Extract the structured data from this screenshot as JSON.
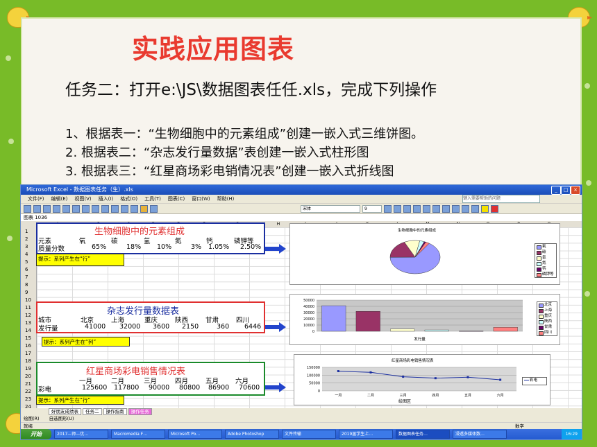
{
  "slide": {
    "title": "实践应用图表",
    "task": "任务二：打开e:\\JS\\数据图表任任.xls，完成下列操作",
    "steps": [
      "1、根据表一：“生物细胞中的元素组成”创建一嵌入式三维饼图。",
      "2.   根据表二：“杂志发行量数据”表创建一嵌入式柱形图",
      "3.   根据表三：“红星商场彩电销情况表”创建一嵌入式折线图"
    ]
  },
  "excel": {
    "window_title": "Microsoft Excel - 数据图表任务（生）.xls",
    "menu": [
      "文件(F)",
      "编辑(E)",
      "视图(V)",
      "插入(I)",
      "格式(O)",
      "工具(T)",
      "图表(C)",
      "窗口(W)",
      "帮助(H)"
    ],
    "help_placeholder": "键入需要帮助的问题",
    "font_name": "宋体",
    "font_size": "9",
    "name_box": "图表 1036",
    "columns": [
      "A",
      "B",
      "C",
      "D",
      "E",
      "F",
      "G",
      "H",
      "I",
      "J",
      "K",
      "L",
      "M",
      "N",
      "O",
      "P",
      "Q"
    ],
    "rows": [
      "1",
      "2",
      "3",
      "4",
      "5",
      "6",
      "7",
      "8",
      "9",
      "10",
      "11",
      "12",
      "13",
      "14",
      "15",
      "16",
      "17",
      "18",
      "19",
      "20",
      "21",
      "22",
      "23",
      "24"
    ],
    "table1": {
      "title": "生物细胞中的元素组成",
      "headers": [
        "元素",
        "氧",
        "碳",
        "氢",
        "氮",
        "钙",
        "磷钾等"
      ],
      "row_label": "质量分数",
      "values": [
        "65%",
        "18%",
        "10%",
        "3%",
        "1.05%",
        "2.50%"
      ],
      "hint": "提示：系列产生在“行”"
    },
    "table2": {
      "title": "杂志发行量数据表",
      "headers": [
        "城市",
        "北京",
        "上海",
        "重庆",
        "陕西",
        "甘肃",
        "四川"
      ],
      "row_label": "发行量",
      "values": [
        "41000",
        "32000",
        "3600",
        "2150",
        "360",
        "6446"
      ],
      "hint": "提示：系列产生在“列”"
    },
    "table3": {
      "title": "红星商场彩电销售情况表",
      "headers": [
        "",
        "一月",
        "二月",
        "三月",
        "四月",
        "五月",
        "六月"
      ],
      "row_label": "彩电",
      "values": [
        "125600",
        "117800",
        "90000",
        "80800",
        "86900",
        "70600"
      ],
      "hint": "提示：系列产生在“行”"
    },
    "sheet_tabs": [
      "好朋友成绩表",
      "任务二",
      "操作指南",
      "操作任务"
    ],
    "draw_label": "绘图(R)",
    "autoshape_label": "自选图形(U)",
    "status_left": "就绪",
    "status_right": "数字",
    "taskbar": {
      "start": "开始",
      "items": [
        "2017—师—优…",
        "Macromedia F…",
        "Microsoft Po…",
        "Adobe Photoshop",
        "文件传输",
        "2019届学生上…",
        "数据图表任务…",
        "浸透多媒体数…"
      ],
      "clock": "16:29"
    }
  },
  "charts": {
    "pie": {
      "title": "生物细胞中的元素组成",
      "legend": [
        "氧",
        "碳",
        "氢",
        "氮",
        "钙",
        "磷钾等"
      ],
      "colors": [
        "#9999ff",
        "#993366",
        "#ffffcc",
        "#ccffff",
        "#660066",
        "#ff8080"
      ]
    },
    "bar": {
      "xlabel": "发行量",
      "yticks": [
        "50000",
        "40000",
        "30000",
        "20000",
        "10000",
        "0"
      ],
      "legend": [
        "北京",
        "上海",
        "重庆",
        "陕西",
        "甘肃",
        "四川"
      ],
      "colors": [
        "#9999ff",
        "#993366",
        "#ffffcc",
        "#ccffff",
        "#660066",
        "#ff8080"
      ]
    },
    "line": {
      "title": "红星商场彩电销售情况表",
      "yticks": [
        "150000",
        "100000",
        "50000",
        "0"
      ],
      "xticks": [
        "一月",
        "二月",
        "三月",
        "四月",
        "五月",
        "六月"
      ],
      "legend": "彩电",
      "draw_area": "绘图区"
    }
  },
  "chart_data": [
    {
      "type": "pie",
      "title": "生物细胞中的元素组成",
      "categories": [
        "氧",
        "碳",
        "氢",
        "氮",
        "钙",
        "磷钾等"
      ],
      "values": [
        65,
        18,
        10,
        3,
        1.05,
        2.5
      ]
    },
    {
      "type": "bar",
      "xlabel": "发行量",
      "ylim": [
        0,
        50000
      ],
      "series": [
        {
          "name": "北京",
          "values": [
            41000
          ]
        },
        {
          "name": "上海",
          "values": [
            32000
          ]
        },
        {
          "name": "重庆",
          "values": [
            3600
          ]
        },
        {
          "name": "陕西",
          "values": [
            2150
          ]
        },
        {
          "name": "甘肃",
          "values": [
            360
          ]
        },
        {
          "name": "四川",
          "values": [
            6446
          ]
        }
      ]
    },
    {
      "type": "line",
      "title": "红星商场彩电销售情况表",
      "categories": [
        "一月",
        "二月",
        "三月",
        "四月",
        "五月",
        "六月"
      ],
      "ylim": [
        0,
        150000
      ],
      "series": [
        {
          "name": "彩电",
          "values": [
            125600,
            117800,
            90000,
            80800,
            86900,
            70600
          ]
        }
      ]
    }
  ]
}
